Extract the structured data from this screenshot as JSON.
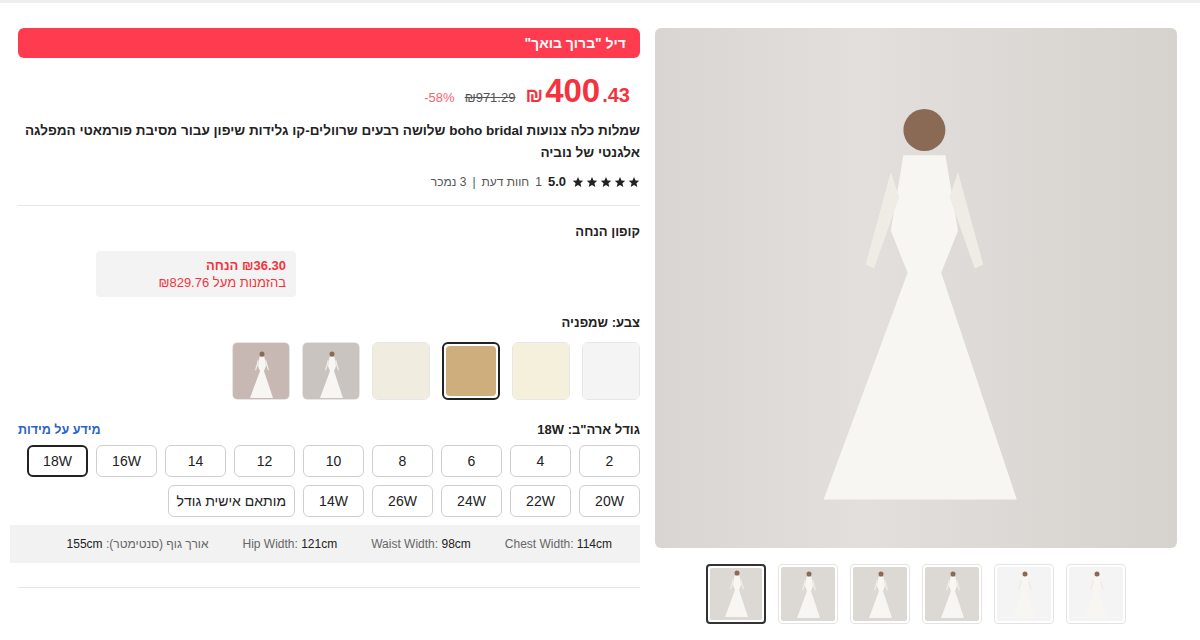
{
  "deal_banner": "דיל \"ברוך בואך\"",
  "price": {
    "currency": "₪",
    "integer": "400",
    "decimals": ".43",
    "original": "₪971.29",
    "discount": "58%-"
  },
  "title": "שמלות כלה צנועות boho bridal שלושה רבעים שרוולים-קו גלידות שיפון עבור מסיבת פורמאטי המפלגה אלגנטי של נוביה",
  "rating": {
    "stars": 5,
    "score": "5.0",
    "reviews_count": "1",
    "reviews_label": "חוות דעת",
    "separator": "|",
    "sold": "3 נמכר"
  },
  "coupon": {
    "label": "קופון הנחה",
    "amount": "₪36.30 הנחה",
    "condition": "בהזמנות מעל ₪829.76"
  },
  "color": {
    "label": "צבע:",
    "value": "שמפניה",
    "swatches": [
      {
        "kind": "color",
        "color": "#f4f4f4",
        "selected": false
      },
      {
        "kind": "color",
        "color": "#f4f0dc",
        "selected": false
      },
      {
        "kind": "color",
        "color": "#cfae7d",
        "selected": true
      },
      {
        "kind": "color",
        "color": "#f0ece0",
        "selected": false
      },
      {
        "kind": "image",
        "color": "#c9c4c0",
        "selected": false
      },
      {
        "kind": "image",
        "color": "#c8b8b4",
        "selected": false
      }
    ]
  },
  "size": {
    "label": "גודל ארה\"ב:",
    "value": "18W",
    "info_link": "מידע על מידות",
    "options": [
      {
        "label": "2",
        "selected": false
      },
      {
        "label": "4",
        "selected": false
      },
      {
        "label": "6",
        "selected": false
      },
      {
        "label": "8",
        "selected": false
      },
      {
        "label": "10",
        "selected": false
      },
      {
        "label": "12",
        "selected": false
      },
      {
        "label": "14",
        "selected": false
      },
      {
        "label": "16W",
        "selected": false
      },
      {
        "label": "18W",
        "selected": true
      },
      {
        "label": "20W",
        "selected": false
      },
      {
        "label": "22W",
        "selected": false
      },
      {
        "label": "24W",
        "selected": false
      },
      {
        "label": "26W",
        "selected": false
      },
      {
        "label": "14W",
        "selected": false
      },
      {
        "label": "מותאם אישית גודל",
        "selected": false
      }
    ]
  },
  "measurements": [
    {
      "label": "Chest Width:",
      "value": "114cm"
    },
    {
      "label": "Waist Width:",
      "value": "98cm"
    },
    {
      "label": "Hip Width:",
      "value": "121cm"
    },
    {
      "label": "אורך גוף (סנטימטר):",
      "value": "155cm"
    }
  ],
  "gallery": {
    "thumbnails": [
      {
        "selected": true
      },
      {
        "selected": false
      },
      {
        "selected": false
      },
      {
        "selected": false
      },
      {
        "selected": false
      },
      {
        "selected": false
      }
    ]
  }
}
